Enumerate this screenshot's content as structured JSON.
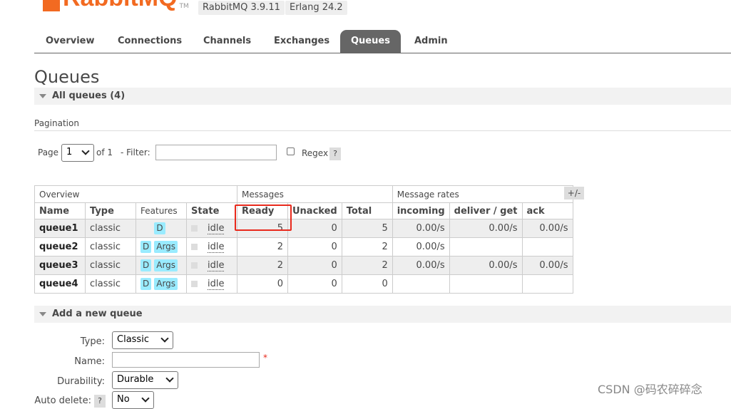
{
  "header": {
    "logo_text": "RabbitMQ",
    "logo_tm": "TM",
    "version": "RabbitMQ 3.9.11",
    "erlang": "Erlang 24.2"
  },
  "nav": {
    "tabs": [
      {
        "label": "Overview"
      },
      {
        "label": "Connections"
      },
      {
        "label": "Channels"
      },
      {
        "label": "Exchanges"
      },
      {
        "label": "Queues",
        "active": true
      },
      {
        "label": "Admin"
      }
    ]
  },
  "page": {
    "title": "Queues",
    "all_queues_label": "All queues (4)",
    "pagination_label": "Pagination"
  },
  "pagination": {
    "page_label": "Page",
    "page_value": "1",
    "of_label": "of 1",
    "filter_label": "- Filter:",
    "filter_value": "",
    "regex_label": "Regex",
    "help_label": "?"
  },
  "table": {
    "group_headers": {
      "overview": "Overview",
      "messages": "Messages",
      "message_rates": "Message rates"
    },
    "columns": {
      "name": "Name",
      "type": "Type",
      "features": "Features",
      "state": "State",
      "ready": "Ready",
      "unacked": "Unacked",
      "total": "Total",
      "incoming": "incoming",
      "deliver_get": "deliver / get",
      "ack": "ack"
    },
    "toggle_label": "+/-",
    "rows": [
      {
        "name": "queue1",
        "type": "classic",
        "feat_d": "D",
        "feat_args": "",
        "state": "idle",
        "ready": "5",
        "unacked": "0",
        "total": "5",
        "incoming": "0.00/s",
        "deliver_get": "0.00/s",
        "ack": "0.00/s"
      },
      {
        "name": "queue2",
        "type": "classic",
        "feat_d": "D",
        "feat_args": "Args",
        "state": "idle",
        "ready": "2",
        "unacked": "0",
        "total": "2",
        "incoming": "0.00/s",
        "deliver_get": "",
        "ack": ""
      },
      {
        "name": "queue3",
        "type": "classic",
        "feat_d": "D",
        "feat_args": "Args",
        "state": "idle",
        "ready": "2",
        "unacked": "0",
        "total": "2",
        "incoming": "0.00/s",
        "deliver_get": "0.00/s",
        "ack": "0.00/s"
      },
      {
        "name": "queue4",
        "type": "classic",
        "feat_d": "D",
        "feat_args": "Args",
        "state": "idle",
        "ready": "0",
        "unacked": "0",
        "total": "0",
        "incoming": "",
        "deliver_get": "",
        "ack": ""
      }
    ]
  },
  "add_queue": {
    "title": "Add a new queue",
    "type_label": "Type:",
    "type_value": "Classic",
    "name_label": "Name:",
    "name_value": "",
    "required_mark": "*",
    "durability_label": "Durability:",
    "durability_value": "Durable",
    "auto_delete_label": "Auto delete:",
    "auto_delete_help": "?",
    "auto_delete_value": "No"
  },
  "watermark": "CSDN @码农碎碎念",
  "colors": {
    "accent": "#f26a21",
    "tab_active": "#666666",
    "feature_badge": "#99ebff",
    "highlight": "#e8291c"
  }
}
